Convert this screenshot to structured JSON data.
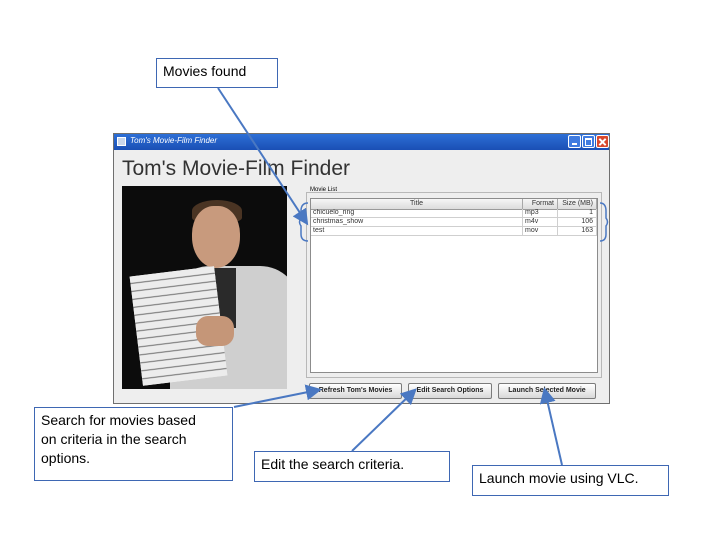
{
  "window": {
    "title": "Tom's Movie-Film Finder",
    "heading": "Tom's Movie-Film Finder"
  },
  "movie_list": {
    "label": "Movie List",
    "columns": {
      "title": "Title",
      "format": "Format",
      "size": "Size (MB)"
    },
    "rows": [
      {
        "title": "chicuelo_ring",
        "format": "mp3",
        "size": "1"
      },
      {
        "title": "christmas_show",
        "format": "m4v",
        "size": "106"
      },
      {
        "title": "test",
        "format": "mov",
        "size": "163"
      }
    ]
  },
  "buttons": {
    "refresh": "Refresh Tom's Movies",
    "edit": "Edit Search Options",
    "launch": "Launch Selected Movie"
  },
  "annotations": {
    "movies_found": "Movies found",
    "search_1": "Search for movies based",
    "search_2": "on criteria in the search",
    "search_3": "options.",
    "edit": "Edit the search criteria.",
    "launch": "Launch movie using VLC."
  },
  "colors": {
    "titlebar": "#1f5cc4",
    "annotation_line": "#4a78c2"
  }
}
